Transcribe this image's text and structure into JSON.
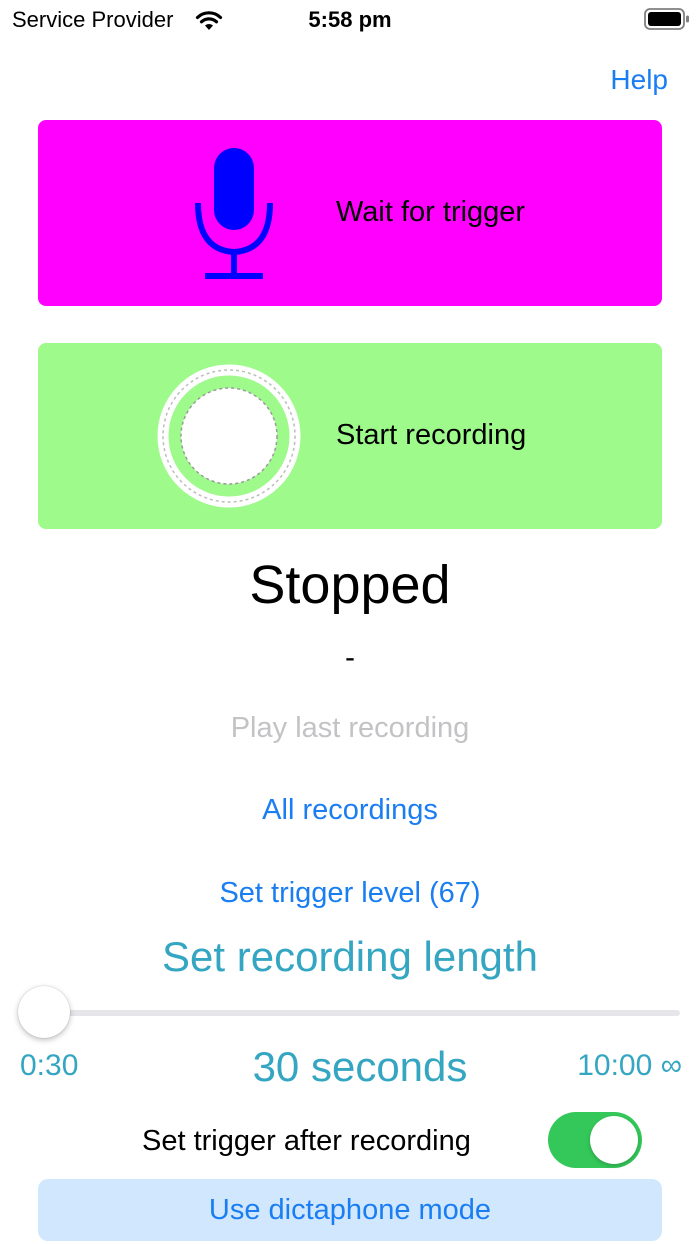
{
  "status_bar": {
    "carrier": "Service Provider",
    "time": "5:58 pm",
    "wifi_icon": "wifi-icon",
    "battery_icon": "battery-icon"
  },
  "nav": {
    "help_label": "Help"
  },
  "trigger_button": {
    "label": "Wait for trigger",
    "icon": "microphone-icon",
    "bg_color": "#ff00ff",
    "icon_color": "#0000ff"
  },
  "record_button": {
    "label": "Start recording",
    "icon": "record-icon",
    "bg_color": "#9efa8b"
  },
  "status": {
    "state": "Stopped",
    "detail": "-"
  },
  "actions": {
    "play_last": "Play last recording",
    "all_recordings": "All recordings",
    "set_trigger_level": "Set trigger level (67)"
  },
  "recording_length": {
    "title": "Set recording length",
    "min_label": "0:30",
    "value_label": "30 seconds",
    "max_label": "10:00 ∞",
    "slider_fraction": 0.0
  },
  "trigger_after": {
    "label": "Set trigger after recording",
    "enabled": true,
    "toggle_color": "#34c759"
  },
  "dictaphone": {
    "label": "Use dictaphone mode",
    "bg_color": "#d1e7fd",
    "text_color": "#1a7ef2"
  },
  "colors": {
    "link_blue": "#1a7ef2",
    "teal": "#34a6c2",
    "disabled_gray": "#c3c3c6"
  }
}
